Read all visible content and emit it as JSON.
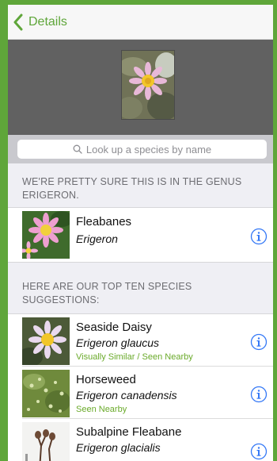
{
  "nav": {
    "back_label": "Details"
  },
  "search": {
    "placeholder": "Look up a species by name"
  },
  "genus_section": {
    "header": "WE'RE PRETTY SURE THIS IS IN THE GENUS ERIGERON.",
    "item": {
      "name": "Fleabanes",
      "scientific": "Erigeron"
    }
  },
  "species_section": {
    "header": "HERE ARE OUR TOP TEN SPECIES SUGGESTIONS:",
    "items": [
      {
        "name": "Seaside Daisy",
        "scientific": "Erigeron glaucus",
        "tag": "Visually Similar / Seen Nearby"
      },
      {
        "name": "Horseweed",
        "scientific": "Erigeron canadensis",
        "tag": "Seen Nearby"
      },
      {
        "name": "Subalpine Fleabane",
        "scientific": "Erigeron glacialis",
        "tag": ""
      }
    ]
  },
  "icons": {
    "back": "chevron-left-icon",
    "search": "search-icon",
    "info": "info-circle-icon"
  },
  "colors": {
    "accent": "#5fa63a",
    "tag_green": "#6aaa2a",
    "info_blue": "#3478f6",
    "header_bg": "#616161"
  }
}
